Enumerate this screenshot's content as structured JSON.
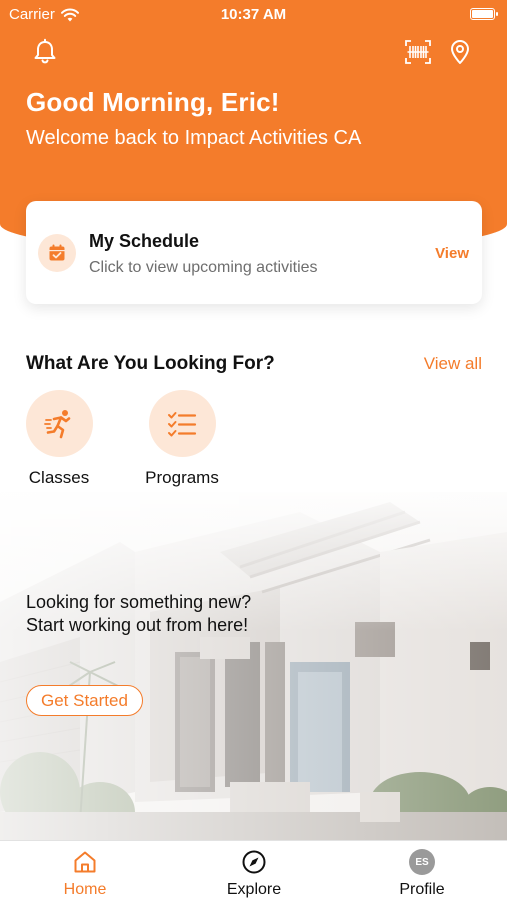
{
  "colors": {
    "accent": "#f47c2b",
    "accent_soft": "#fde7d7"
  },
  "status_bar": {
    "carrier": "Carrier",
    "time": "10:37 AM"
  },
  "header": {
    "icons": [
      "bell-icon",
      "barcode-scan-icon",
      "location-pin-icon"
    ],
    "greeting": "Good Morning, Eric!",
    "welcome": "Welcome back to Impact Activities CA"
  },
  "schedule": {
    "icon": "calendar-check-icon",
    "title": "My Schedule",
    "subtitle": "Click to view upcoming activities",
    "view_label": "View"
  },
  "categories_section": {
    "title": "What Are You Looking For?",
    "view_all_label": "View all",
    "items": [
      {
        "label": "Classes",
        "icon": "running-person-icon"
      },
      {
        "label": "Programs",
        "icon": "checklist-icon"
      }
    ]
  },
  "promo": {
    "line1": "Looking for something new?",
    "line2": "Start working out from here!",
    "button_label": "Get Started"
  },
  "tabbar": {
    "tabs": [
      {
        "label": "Home",
        "icon": "home-icon",
        "active": true
      },
      {
        "label": "Explore",
        "icon": "compass-icon",
        "active": false
      },
      {
        "label": "Profile",
        "icon": "avatar",
        "initials": "ES",
        "active": false
      }
    ]
  }
}
